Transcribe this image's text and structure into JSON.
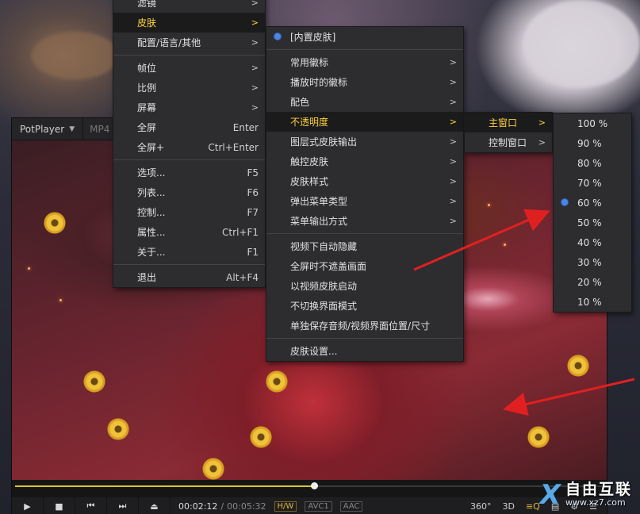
{
  "player": {
    "logo": "PotPlayer",
    "format": "MP4",
    "progress": 0.51,
    "time_current": "00:02:12",
    "time_separator": "/",
    "time_total": "00:05:32",
    "tags": [
      "H/W",
      "AVC1",
      "AAC"
    ],
    "right_controls": [
      "360°",
      "3D",
      "≡Q",
      "▤",
      "⚙",
      "☰"
    ]
  },
  "menu_main": {
    "items": [
      {
        "label": "滤镜",
        "type": "sub"
      },
      {
        "label": "皮肤",
        "type": "sub",
        "active": true
      },
      {
        "label": "配置/语言/其他",
        "type": "sub"
      },
      {
        "sep": true
      },
      {
        "label": "帧位",
        "type": "sub"
      },
      {
        "label": "比例",
        "type": "sub"
      },
      {
        "label": "屏幕",
        "type": "sub"
      },
      {
        "label": "全屏",
        "shortcut": "Enter"
      },
      {
        "label": "全屏+",
        "shortcut": "Ctrl+Enter"
      },
      {
        "sep": true
      },
      {
        "label": "选项...",
        "shortcut": "F5"
      },
      {
        "label": "列表...",
        "shortcut": "F6"
      },
      {
        "label": "控制...",
        "shortcut": "F7"
      },
      {
        "label": "属性...",
        "shortcut": "Ctrl+F1"
      },
      {
        "label": "关于...",
        "shortcut": "F1"
      },
      {
        "sep": true
      },
      {
        "label": "退出",
        "shortcut": "Alt+F4"
      }
    ]
  },
  "menu_skin": {
    "items": [
      {
        "label": "[内置皮肤]",
        "checked": true
      },
      {
        "sep": true
      },
      {
        "label": "常用徽标",
        "type": "sub"
      },
      {
        "label": "播放时的徽标",
        "type": "sub"
      },
      {
        "label": "配色",
        "type": "sub"
      },
      {
        "label": "不透明度",
        "type": "sub",
        "active": true
      },
      {
        "label": "图层式皮肤输出",
        "type": "sub"
      },
      {
        "label": "触控皮肤",
        "type": "sub"
      },
      {
        "label": "皮肤样式",
        "type": "sub"
      },
      {
        "label": "弹出菜单类型",
        "type": "sub"
      },
      {
        "label": "菜单输出方式",
        "type": "sub"
      },
      {
        "sep": true
      },
      {
        "label": "视频下自动隐藏"
      },
      {
        "label": "全屏时不遮盖画面"
      },
      {
        "label": "以视频皮肤启动"
      },
      {
        "label": "不切换界面模式"
      },
      {
        "label": "单独保存音频/视频界面位置/尺寸"
      },
      {
        "sep": true
      },
      {
        "label": "皮肤设置..."
      }
    ]
  },
  "menu_opacity_target": {
    "items": [
      {
        "label": "主窗口",
        "type": "sub",
        "active": true
      },
      {
        "label": "控制窗口",
        "type": "sub"
      }
    ]
  },
  "menu_opacity_level": {
    "items": [
      {
        "label": "100 %"
      },
      {
        "label": "90 %"
      },
      {
        "label": "80 %"
      },
      {
        "label": "70 %"
      },
      {
        "label": "60 %",
        "checked": true
      },
      {
        "label": "50 %"
      },
      {
        "label": "40 %"
      },
      {
        "label": "30 %"
      },
      {
        "label": "20 %"
      },
      {
        "label": "10 %"
      }
    ]
  },
  "watermark": {
    "logo_mark": "X",
    "title": "自由互联",
    "url": "www.xz7.com"
  },
  "colors": {
    "accent_yellow": "#ffd23c",
    "check_blue": "#4b86e6",
    "annotation_red": "#e02020"
  }
}
